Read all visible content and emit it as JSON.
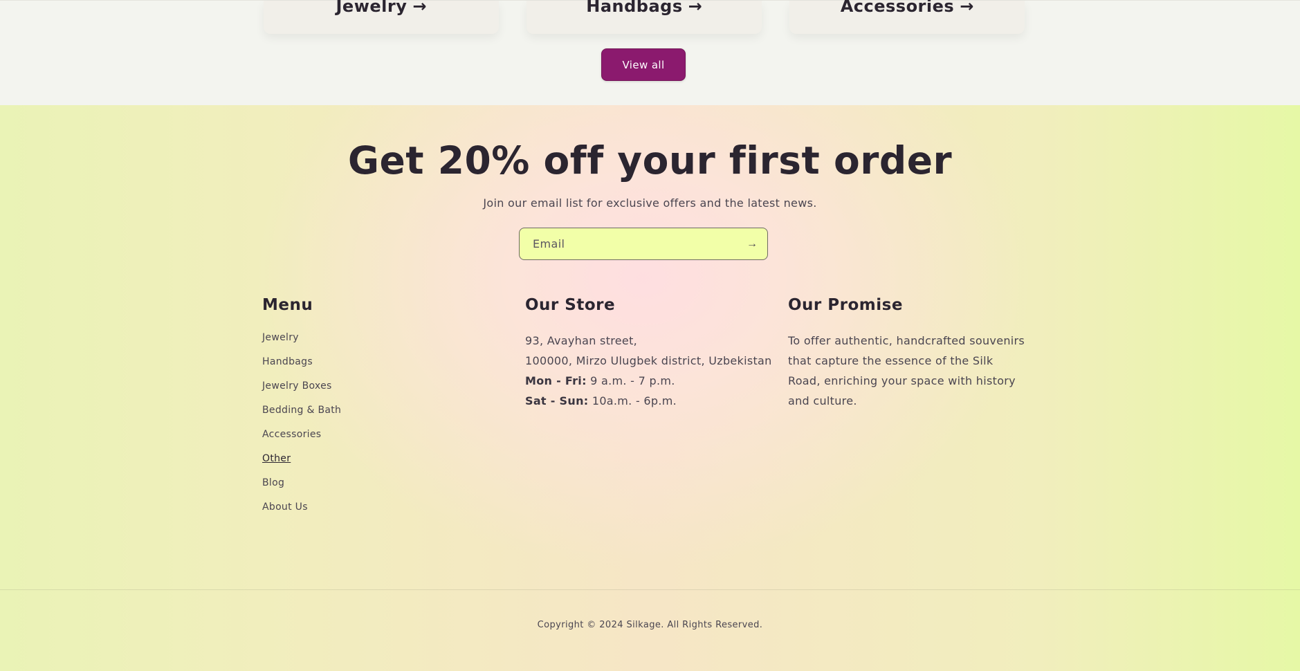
{
  "collections": {
    "cards": [
      {
        "title": "Jewelry",
        "arrow": "→"
      },
      {
        "title": "Handbags",
        "arrow": "→"
      },
      {
        "title": "Accessories",
        "arrow": "→"
      }
    ],
    "view_all_label": "View all"
  },
  "newsletter": {
    "headline": "Get 20% off your first order",
    "subline": "Join our email list for exclusive offers and the latest news.",
    "email_placeholder": "Email",
    "email_value": "",
    "submit_icon": "arrow-right-icon",
    "submit_glyph": "→"
  },
  "footer": {
    "menu": {
      "title": "Menu",
      "items": [
        "Jewelry",
        "Handbags",
        "Jewelry Boxes",
        "Bedding & Bath",
        "Accessories",
        "Other",
        "Blog",
        "About Us"
      ],
      "active": "Other"
    },
    "store": {
      "title": "Our Store",
      "address_line1": "93, Avayhan street,",
      "address_line2": "100000, Mirzo Ulugbek district, Uzbekistan",
      "weekday_label": "Mon - Fri:",
      "weekday_hours": "9 a.m. - 7 p.m.",
      "weekend_label": "Sat - Sun:",
      "weekend_hours": "10a.m. - 6p.m."
    },
    "promise": {
      "title": "Our Promise",
      "text": "To offer authentic, handcrafted souvenirs that capture the essence of the Silk Road, enriching your space with history and culture."
    },
    "copyright": "Copyright © 2024 Silkage. All Rights Reserved."
  },
  "colors": {
    "accent": "#8b1a6e",
    "text": "#2b2530",
    "email_field_bg": "#f2ffa8",
    "page_bg_top": "#f3f4ef"
  }
}
